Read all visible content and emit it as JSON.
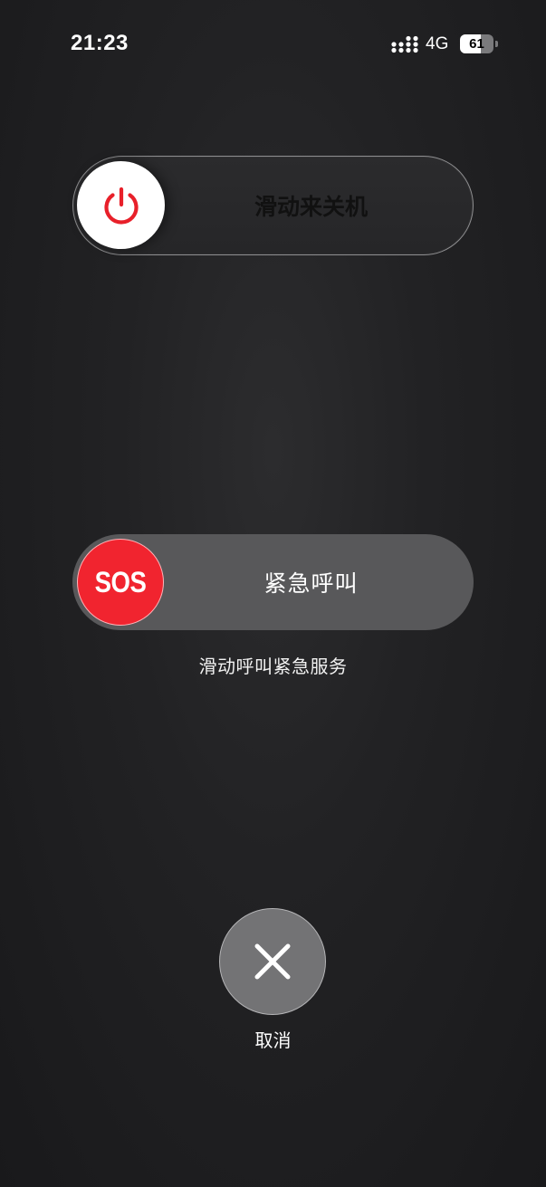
{
  "status_bar": {
    "time": "21:23",
    "network": "4G",
    "battery": "61",
    "battery_level": 0.61,
    "signal_icon": "signal-dots-icon"
  },
  "power_slider": {
    "label": "滑动来关机",
    "icon": "power-icon",
    "icon_color": "#e8202a"
  },
  "sos_slider": {
    "knob_text": "SOS",
    "label": "紧急呼叫",
    "hint": "滑动呼叫紧急服务",
    "knob_color": "#f1242f"
  },
  "cancel": {
    "icon": "close-icon",
    "label": "取消"
  }
}
